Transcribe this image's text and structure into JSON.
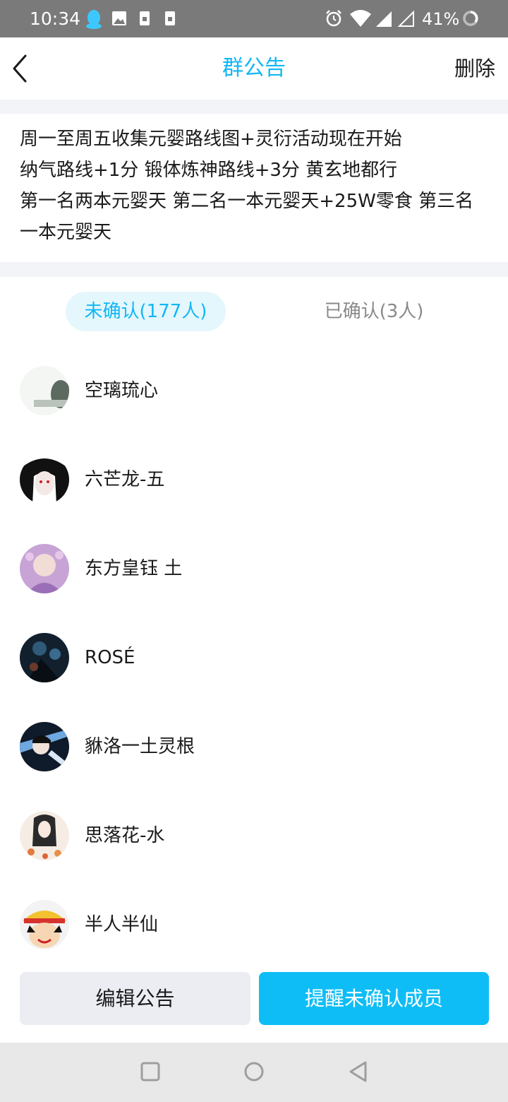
{
  "status_bar": {
    "time": "10:34",
    "battery": "41%",
    "icons": [
      "qq-icon",
      "image-icon",
      "sim-icon",
      "sim-icon",
      "alarm-icon",
      "wifi-icon",
      "signal-icon",
      "signal-empty-icon",
      "battery-ring-icon"
    ]
  },
  "header": {
    "title": "群公告",
    "delete_label": "删除"
  },
  "announcement": {
    "text": "周一至周五收集元婴路线图+灵衍活动现在开始\n纳气路线+1分 锻体炼神路线+3分 黄玄地都行\n第一名两本元婴天 第二名一本元婴天+25W零食 第三名一本元婴天"
  },
  "tabs": {
    "unconfirmed": "未确认(177人)",
    "confirmed": "已确认(3人)"
  },
  "members": [
    {
      "name": "空璃琉心"
    },
    {
      "name": "六芒龙-五"
    },
    {
      "name": "东方皇钰 土"
    },
    {
      "name": "ROSÉ"
    },
    {
      "name": "貅洛一土灵根"
    },
    {
      "name": "思落花-水"
    },
    {
      "name": "半人半仙"
    }
  ],
  "actions": {
    "edit_label": "编辑公告",
    "remind_label": "提醒未确认成员"
  },
  "colors": {
    "accent": "#12b7f5",
    "button_primary": "#0fbdf6",
    "status_bar": "#7a7a7a"
  }
}
